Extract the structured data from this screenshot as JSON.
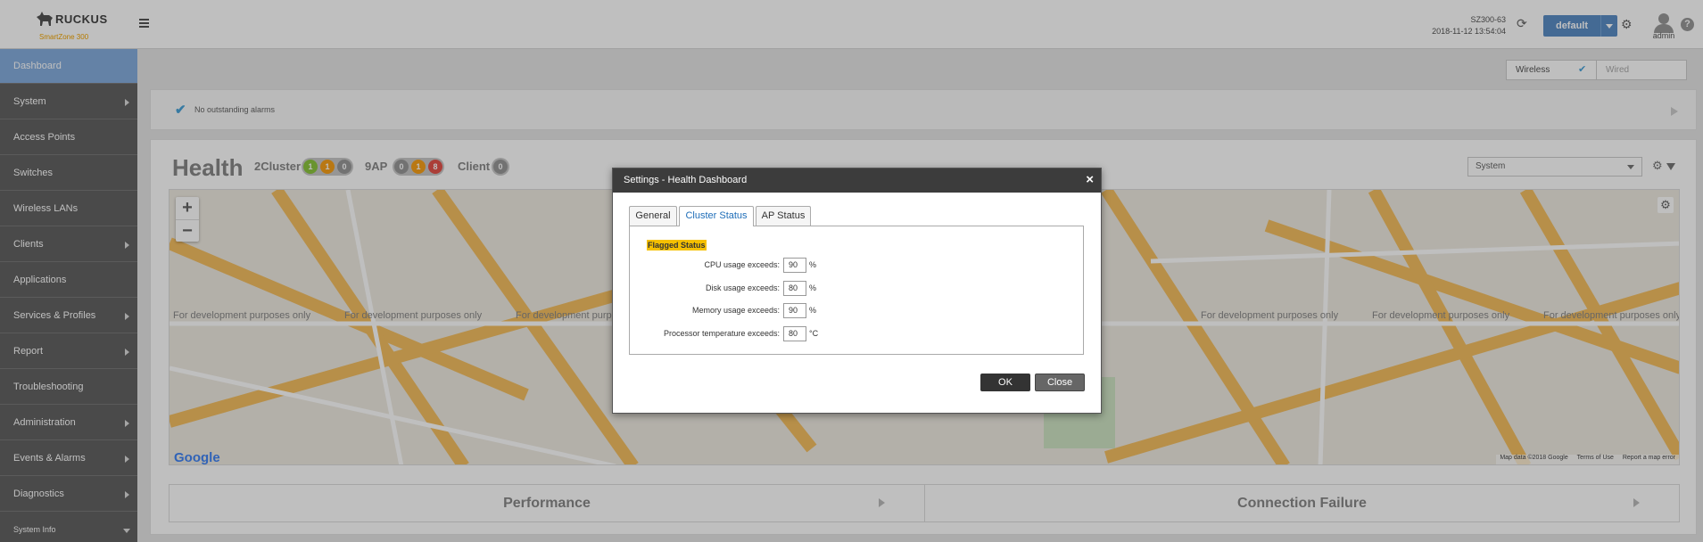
{
  "header": {
    "brand": "RUCKUS",
    "product": "SmartZone 300",
    "system_name": "SZ300-63",
    "datetime": "2018-11-12  13:54:04",
    "domain_button": "default",
    "user": "admin",
    "help_glyph": "?"
  },
  "sidebar": {
    "items": [
      {
        "label": "Dashboard",
        "active": true,
        "arrow": false
      },
      {
        "label": "System",
        "arrow": true
      },
      {
        "label": "Access Points",
        "arrow": false
      },
      {
        "label": "Switches",
        "arrow": false
      },
      {
        "label": "Wireless LANs",
        "arrow": false
      },
      {
        "label": "Clients",
        "arrow": true
      },
      {
        "label": "Applications",
        "arrow": false
      },
      {
        "label": "Services & Profiles",
        "arrow": true
      },
      {
        "label": "Report",
        "arrow": true
      },
      {
        "label": "Troubleshooting",
        "arrow": false
      },
      {
        "label": "Administration",
        "arrow": true
      },
      {
        "label": "Events & Alarms",
        "arrow": true
      },
      {
        "label": "Diagnostics",
        "arrow": true
      },
      {
        "label": "System Info",
        "arrow": "down"
      }
    ]
  },
  "toggle": {
    "wireless": "Wireless",
    "wired": "Wired"
  },
  "alarms": {
    "text": "No outstanding alarms"
  },
  "health": {
    "title": "Health",
    "cluster_label": "2Cluster",
    "cluster_counts": [
      "1",
      "1",
      "0"
    ],
    "ap_label": "9AP",
    "ap_counts": [
      "0",
      "1",
      "8"
    ],
    "client_label": "Client",
    "client_count": "0",
    "scope_select": "System"
  },
  "map": {
    "dev_notice": "For development purposes only",
    "google": "Google",
    "attribution": [
      "Map data ©2018 Google",
      "Terms of Use",
      "Report a map error"
    ]
  },
  "panels": {
    "performance": "Performance",
    "connection_failure": "Connection Failure"
  },
  "dialog": {
    "title": "Settings - Health Dashboard",
    "close_glyph": "×",
    "tabs": [
      "General",
      "Cluster Status",
      "AP Status"
    ],
    "active_tab": "Cluster Status",
    "section": "Flagged Status",
    "rows": [
      {
        "label": "CPU usage exceeds:",
        "value": "90",
        "unit": "%"
      },
      {
        "label": "Disk usage exceeds:",
        "value": "80",
        "unit": "%"
      },
      {
        "label": "Memory usage exceeds:",
        "value": "90",
        "unit": "%"
      },
      {
        "label": "Processor temperature exceeds:",
        "value": "80",
        "unit": "°C"
      }
    ],
    "ok": "OK",
    "close": "Close"
  }
}
